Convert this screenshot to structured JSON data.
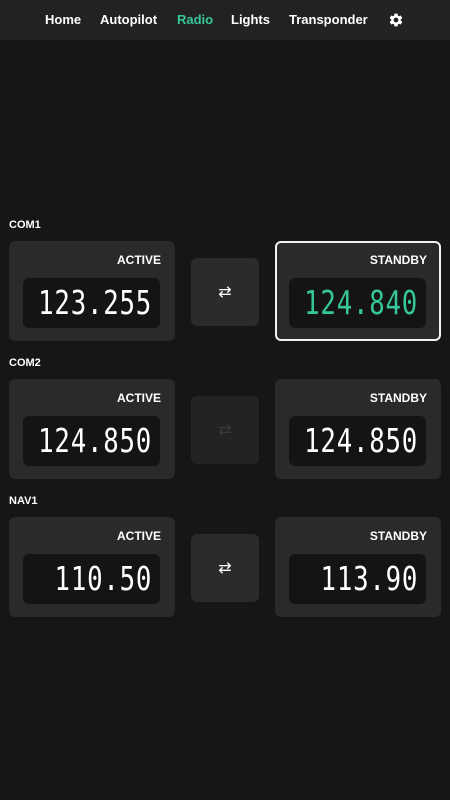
{
  "nav": {
    "items": [
      "Home",
      "Autopilot",
      "Radio",
      "Lights",
      "Transponder"
    ],
    "active": "Radio",
    "settings_icon": "gear-icon"
  },
  "colors": {
    "background": "#161616",
    "topbar": "#222222",
    "panel": "#2a2a2a",
    "accent": "#35c79a"
  },
  "radios": [
    {
      "label": "COM1",
      "active": {
        "title": "ACTIVE",
        "frequency": "123.255"
      },
      "standby": {
        "title": "STANDBY",
        "frequency": "124.840",
        "selected": true
      },
      "swap_icon": "swap-arrows-icon",
      "swap_enabled": true
    },
    {
      "label": "COM2",
      "active": {
        "title": "ACTIVE",
        "frequency": "124.850"
      },
      "standby": {
        "title": "STANDBY",
        "frequency": "124.850",
        "selected": false
      },
      "swap_icon": "swap-arrows-icon",
      "swap_enabled": false
    },
    {
      "label": "NAV1",
      "active": {
        "title": "ACTIVE",
        "frequency": "110.50"
      },
      "standby": {
        "title": "STANDBY",
        "frequency": "113.90",
        "selected": false
      },
      "swap_icon": "swap-arrows-icon",
      "swap_enabled": true
    }
  ]
}
